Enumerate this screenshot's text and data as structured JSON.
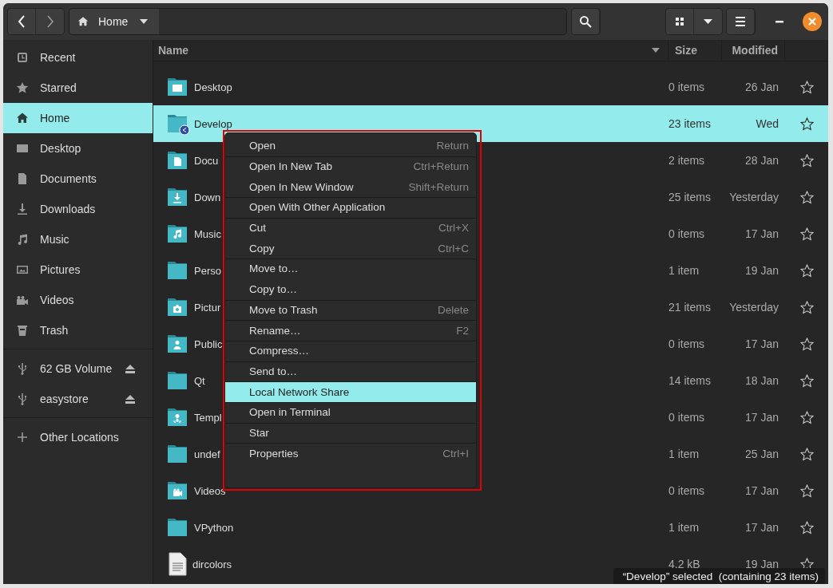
{
  "header": {
    "path": "Home"
  },
  "sidebar": {
    "groups": [
      [
        {
          "kind": "recent",
          "label": "Recent",
          "selected": false,
          "eject": false
        },
        {
          "kind": "starred",
          "label": "Starred",
          "selected": false,
          "eject": false
        },
        {
          "kind": "home",
          "label": "Home",
          "selected": true,
          "eject": false
        },
        {
          "kind": "desktop",
          "label": "Desktop",
          "selected": false,
          "eject": false
        },
        {
          "kind": "documents",
          "label": "Documents",
          "selected": false,
          "eject": false
        },
        {
          "kind": "downloads",
          "label": "Downloads",
          "selected": false,
          "eject": false
        },
        {
          "kind": "music",
          "label": "Music",
          "selected": false,
          "eject": false
        },
        {
          "kind": "pictures",
          "label": "Pictures",
          "selected": false,
          "eject": false
        },
        {
          "kind": "videos",
          "label": "Videos",
          "selected": false,
          "eject": false
        },
        {
          "kind": "trash",
          "label": "Trash",
          "selected": false,
          "eject": false
        }
      ],
      [
        {
          "kind": "usb",
          "label": "62 GB Volume",
          "selected": false,
          "eject": true
        },
        {
          "kind": "usb",
          "label": "easystore",
          "selected": false,
          "eject": true
        }
      ],
      [
        {
          "kind": "other",
          "label": "Other Locations",
          "selected": false,
          "eject": false
        }
      ]
    ]
  },
  "table": {
    "columns": [
      "Name",
      "Size",
      "Modified"
    ],
    "rows": [
      {
        "kind": "desktop",
        "name": "Desktop",
        "size": "0 items",
        "modified": "26 Jan",
        "starred": false,
        "selected": false
      },
      {
        "kind": "shared",
        "name": "Develop",
        "size": "23 items",
        "modified": "Wed",
        "starred": false,
        "selected": true
      },
      {
        "kind": "documents",
        "name": "Docu",
        "size": "2 items",
        "modified": "28 Jan",
        "starred": false,
        "selected": false
      },
      {
        "kind": "downloads",
        "name": "Down",
        "size": "25 items",
        "modified": "Yesterday",
        "starred": false,
        "selected": false
      },
      {
        "kind": "music",
        "name": "Music",
        "size": "0 items",
        "modified": "17 Jan",
        "starred": false,
        "selected": false
      },
      {
        "kind": "plain",
        "name": "Perso",
        "size": "1 item",
        "modified": "19 Jan",
        "starred": false,
        "selected": false
      },
      {
        "kind": "pictures",
        "name": "Pictur",
        "size": "21 items",
        "modified": "Yesterday",
        "starred": false,
        "selected": false
      },
      {
        "kind": "public",
        "name": "Public",
        "size": "0 items",
        "modified": "17 Jan",
        "starred": false,
        "selected": false
      },
      {
        "kind": "plain",
        "name": "Qt",
        "size": "14 items",
        "modified": "18 Jan",
        "starred": false,
        "selected": false
      },
      {
        "kind": "templates",
        "name": "Templ",
        "size": "0 items",
        "modified": "17 Jan",
        "starred": false,
        "selected": false
      },
      {
        "kind": "plain",
        "name": "undef",
        "size": "1 item",
        "modified": "25 Jan",
        "starred": false,
        "selected": false
      },
      {
        "kind": "videos",
        "name": "Videos",
        "size": "0 items",
        "modified": "17 Jan",
        "starred": false,
        "selected": false
      },
      {
        "kind": "plain",
        "name": "VPython",
        "size": "1 item",
        "modified": "17 Jan",
        "starred": false,
        "selected": false
      },
      {
        "kind": "file",
        "name": "dircolors",
        "size": "4.2 kB",
        "modified": "19 Jan",
        "starred": false,
        "selected": false
      }
    ]
  },
  "context_menu": {
    "items": [
      {
        "label": "Open",
        "shortcut": "Return",
        "divider_above": false,
        "selected": false
      },
      {
        "label": "Open In New Tab",
        "shortcut": "Ctrl+Return",
        "divider_above": true,
        "selected": false
      },
      {
        "label": "Open In New Window",
        "shortcut": "Shift+Return",
        "divider_above": false,
        "selected": false
      },
      {
        "label": "Open With Other Application",
        "divider_above": true,
        "selected": false
      },
      {
        "label": "Cut",
        "shortcut": "Ctrl+X",
        "divider_above": true,
        "selected": false
      },
      {
        "label": "Copy",
        "shortcut": "Ctrl+C",
        "divider_above": false,
        "selected": false
      },
      {
        "label": "Move to…",
        "divider_above": true,
        "selected": false
      },
      {
        "label": "Copy to…",
        "divider_above": false,
        "selected": false
      },
      {
        "label": "Move to Trash",
        "shortcut": "Delete",
        "divider_above": true,
        "selected": false
      },
      {
        "label": "Rename…",
        "shortcut": "F2",
        "divider_above": true,
        "selected": false
      },
      {
        "label": "Compress…",
        "divider_above": true,
        "selected": false
      },
      {
        "label": "Send to…",
        "divider_above": true,
        "selected": false
      },
      {
        "label": "Local Network Share",
        "divider_above": true,
        "selected": true
      },
      {
        "label": "Open in Terminal",
        "divider_above": true,
        "selected": false
      },
      {
        "label": "Star",
        "divider_above": true,
        "selected": false
      },
      {
        "label": "Properties",
        "shortcut": "Ctrl+I",
        "divider_above": true,
        "selected": false
      }
    ]
  },
  "status": "“Develop” selected  (containing 23 items)"
}
